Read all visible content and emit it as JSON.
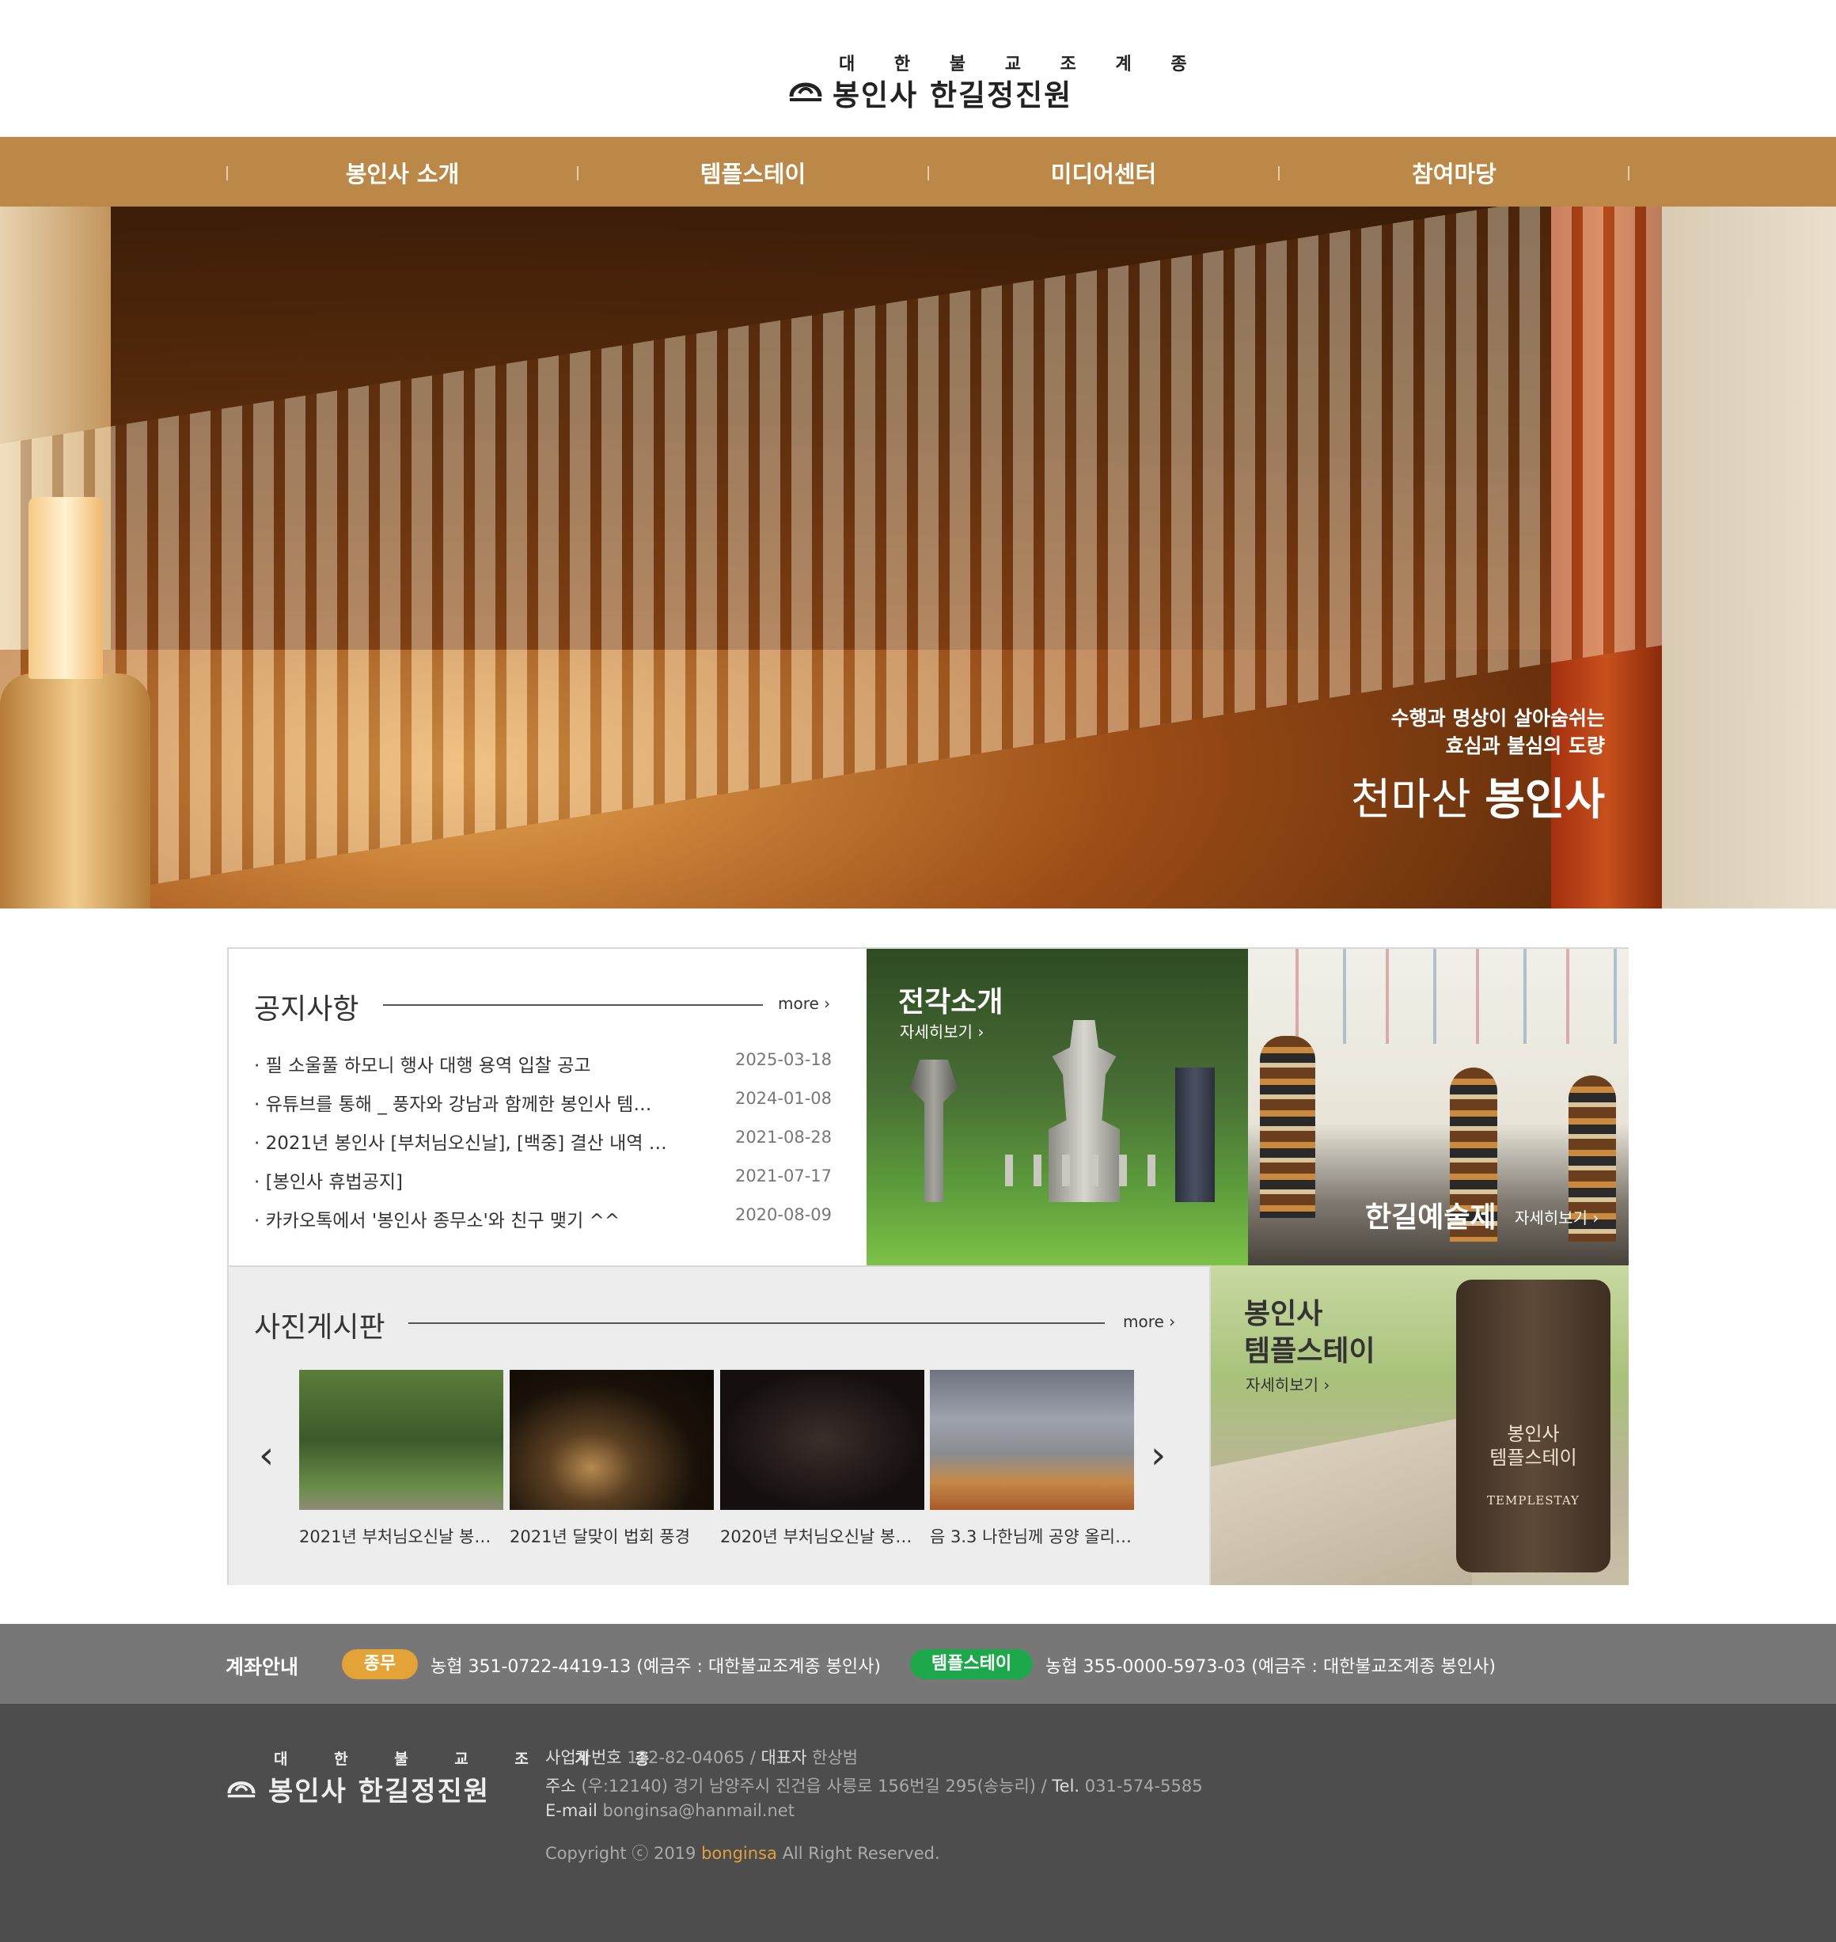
{
  "logo": {
    "sect": "대 한 불 교 조 계 종",
    "name": "봉인사 한길정진원"
  },
  "nav": {
    "items": [
      "봉인사 소개",
      "템플스테이",
      "미디어센터",
      "참여마당"
    ]
  },
  "hero": {
    "line1": "수행과 명상이 살아숨쉬는",
    "line2": "효심과 불심의 도량",
    "title_light": "천마산",
    "title_bold": "봉인사",
    "slide_count": 3,
    "active_slide": 2
  },
  "notice": {
    "title": "공지사항",
    "more": "more ›",
    "items": [
      {
        "text": "· 필 소울풀 하모니 행사 대행 용역 입찰 공고",
        "date": "2025-03-18"
      },
      {
        "text": "· 유튜브를 통해 _ 풍자와 강남과 함께한 봉인사 템…",
        "date": "2024-01-08"
      },
      {
        "text": "· 2021년 봉인사 [부처님오신날], [백중] 결산 내역 …",
        "date": "2021-08-28"
      },
      {
        "text": "· [봉인사 휴법공지]",
        "date": "2021-07-17"
      },
      {
        "text": "· 카카오톡에서 '봉인사 종무소'와 친구 맺기 ^^",
        "date": "2020-08-09"
      }
    ]
  },
  "tiles": {
    "jeongak": {
      "title": "전각소개",
      "sub": "자세히보기 ›"
    },
    "art": {
      "title": "한길예술제",
      "sub": "자세히보기 ›"
    },
    "templestay": {
      "title_line1": "봉인사",
      "title_line2": "템플스테이",
      "sub": "자세히보기 ›",
      "sign_line1": "봉인사",
      "sign_line2": "템플스테이",
      "sign_line3": "TEMPLESTAY"
    }
  },
  "photo": {
    "title": "사진게시판",
    "more": "more ›",
    "prev": "‹",
    "next": "›",
    "items": [
      {
        "caption": "2021년 부처님오신날 봉…"
      },
      {
        "caption": "2021년 달맞이 법회 풍경"
      },
      {
        "caption": "2020년 부처님오신날 봉…"
      },
      {
        "caption": "음 3.3 나한님께 공양 올리…"
      }
    ]
  },
  "account": {
    "label": "계좌안내",
    "tag1": "종무",
    "info1": "농협 351-0722-4419-13 (예금주 : 대한불교조계종 봉인사)",
    "tag2": "템플스테이",
    "info2": "농협 355-0000-5973-03 (예금주 : 대한불교조계종 봉인사)"
  },
  "footer": {
    "biz_label": "사업자번호",
    "biz_no": "132-82-04065",
    "rep_label": "대표자",
    "rep": "한상범",
    "addr_label": "주소",
    "addr": "(우:12140) 경기 남양주시 진건읍 사릉로 156번길 295(송능리)",
    "tel_label": "Tel.",
    "tel": "031-574-5585",
    "email_label": "E-mail",
    "email": "bonginsa@hanmail.net",
    "copy_pre": "Copyright ⓒ 2019",
    "copy_brand": "bonginsa",
    "copy_post": "All Right Reserved."
  },
  "colors": {
    "nav_bg": "#bb8847",
    "account_bg": "#777777",
    "footer_bg": "#4d4d4d",
    "tag_orange": "#e3a336",
    "tag_green": "#1ea84c",
    "dot_active": "#e4a43a"
  }
}
